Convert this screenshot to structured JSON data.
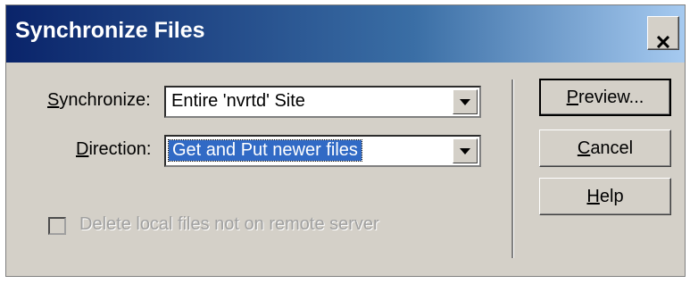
{
  "window": {
    "title": "Synchronize Files",
    "close_glyph": "✕"
  },
  "form": {
    "synchronize": {
      "label_accel": "S",
      "label_rest": "ynchronize:",
      "value": "Entire 'nvrtd' Site"
    },
    "direction": {
      "label_accel": "D",
      "label_rest": "irection:",
      "value": "Get and Put newer files"
    },
    "delete_option": {
      "label": "Delete local files not on remote server",
      "checked": false,
      "enabled": false
    }
  },
  "buttons": {
    "preview": {
      "accel": "P",
      "rest": "review..."
    },
    "cancel": {
      "accel": "C",
      "rest": "ancel"
    },
    "help": {
      "accel": "H",
      "rest": "elp"
    }
  }
}
